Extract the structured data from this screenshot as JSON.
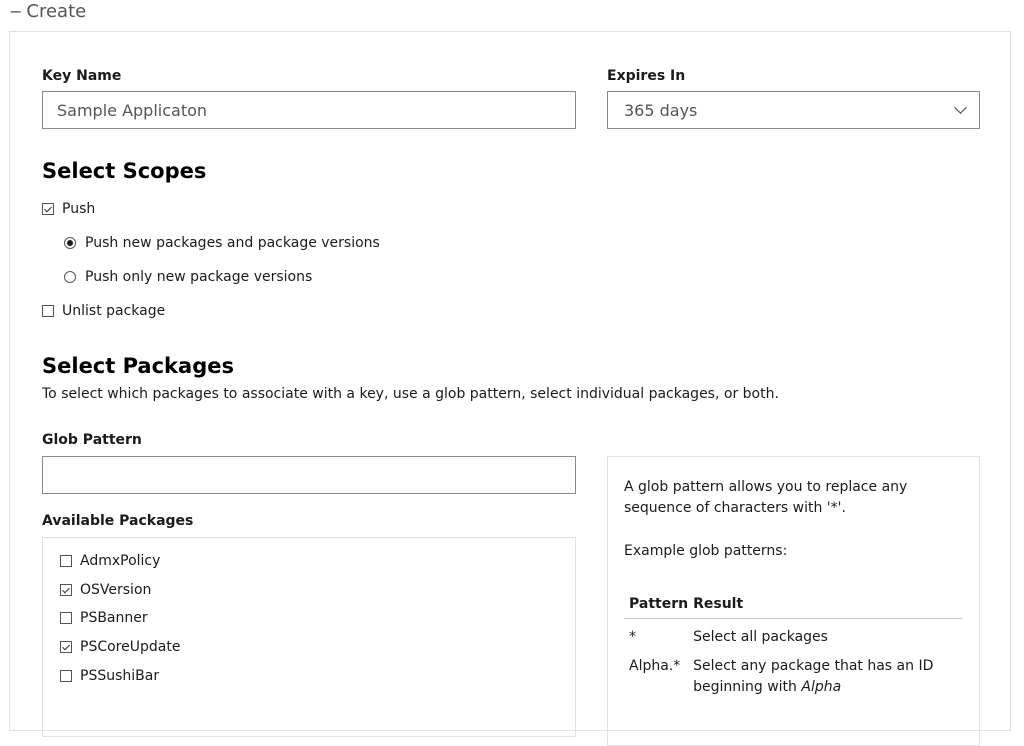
{
  "section": {
    "toggle_symbol": "−",
    "title": "Create"
  },
  "key_name": {
    "label": "Key Name",
    "value": "Sample Applicaton"
  },
  "expires_in": {
    "label": "Expires In",
    "selected": "365 days"
  },
  "scopes": {
    "heading": "Select Scopes",
    "push": {
      "label": "Push",
      "checked": true
    },
    "push_options": [
      {
        "label": "Push new packages and package versions",
        "selected": true
      },
      {
        "label": "Push only new package versions",
        "selected": false
      }
    ],
    "unlist": {
      "label": "Unlist package",
      "checked": false
    }
  },
  "packages": {
    "heading": "Select Packages",
    "description": "To select which packages to associate with a key, use a glob pattern, select individual packages, or both.",
    "glob_label": "Glob Pattern",
    "glob_value": "",
    "available_label": "Available Packages",
    "items": [
      {
        "name": "AdmxPolicy",
        "checked": false
      },
      {
        "name": "OSVersion",
        "checked": true
      },
      {
        "name": "PSBanner",
        "checked": false
      },
      {
        "name": "PSCoreUpdate",
        "checked": true
      },
      {
        "name": "PSSushiBar",
        "checked": false
      }
    ]
  },
  "help": {
    "intro": "A glob pattern allows you to replace any sequence of characters with '*'.",
    "examples_label": "Example glob patterns:",
    "col_pattern": "Pattern",
    "col_result": "Result",
    "rows": [
      {
        "pattern": "*",
        "result_prefix": "Select all packages",
        "result_italic": ""
      },
      {
        "pattern": "Alpha.*",
        "result_prefix": "Select any package that has an ID beginning with ",
        "result_italic": "Alpha"
      }
    ]
  }
}
